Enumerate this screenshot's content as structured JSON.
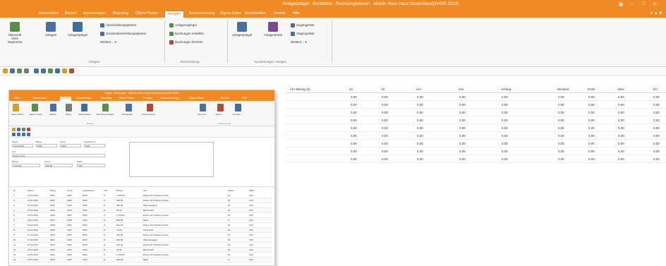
{
  "app": {
    "title": "Anlagespiegel · Kontierbar · Rechnungswesen · Muster Hous Haus Deutschland(AHKR 2010)",
    "window_controls": [
      "▣",
      "–",
      "□",
      "✕"
    ]
  },
  "menu": {
    "tabs": [
      "Stammdaten",
      "Buchen",
      "Auswertungen",
      "Reporting",
      "Offene Posten",
      "Anlagen",
      "Kostenrechnung",
      "Eigene Daten",
      "Schnittstellen",
      "Fenster",
      "Hilfe"
    ],
    "active_index": 5
  },
  "ribbon": {
    "buttons_large": [
      {
        "label": "Übersicht ohne Segmente",
        "icon": "overview-icon"
      },
      {
        "label": "Anlagen",
        "icon": "assets-icon"
      },
      {
        "label": "Anlagespiegel",
        "icon": "asset-register-icon"
      },
      {
        "label": "Anlagespiegel",
        "icon": "asset-chart-icon"
      },
      {
        "label": "Anlagenkarte",
        "icon": "asset-card-icon"
      }
    ],
    "small_items": [
      "Abschreibungsplanen",
      "Sonderabschreibungsplanen",
      "Weitere...",
      "Anlagenspiegel",
      "Buchungen erstellen",
      "Buchungen löschen",
      "Zugangsliste",
      "Abgangsliste",
      "Weitere..."
    ],
    "groups": [
      "Anlagen",
      "Abschreibung",
      "Auswertungen Anlagen"
    ]
  },
  "grid": {
    "columns": [
      "AfA-Betrag (€)",
      "Zu",
      "Ab",
      "Um",
      "Zus",
      "Anfang",
      "Bestand",
      "Ende",
      "Aktiv",
      "AfA"
    ],
    "row_value": "0,00",
    "row_count": 9
  },
  "dialog": {
    "title": "Stapel · Buchungen · Muster Hous Haus Deutschland (AHKR 2010)",
    "tabs": [
      "Start",
      "Stammdaten",
      "Buchen",
      "Auswertungen",
      "Reporting",
      "Offene Posten",
      "Anlagen",
      "Kostenrechnung",
      "Eigene Daten",
      "Fenster",
      "Hilfe"
    ],
    "active_tab": 2,
    "ribbon_labels": [
      "Stapel öffnen",
      "Stapel buchen",
      "Splitten",
      "Beleg",
      "Kostenstellen",
      "Buchungsvorlagen",
      "Belegbilder",
      "Auswertungen",
      "Summen",
      "Export",
      "Drucken"
    ],
    "ribbon_groups": [
      "Buchen",
      "Auswertungen"
    ],
    "form_labels": [
      "Datum",
      "Beleg",
      "Konto",
      "Gegenkonto",
      "Text",
      "Betrag",
      "Steuer",
      "Saldo"
    ],
    "form_values": [
      "13.04.2013",
      "3032",
      "1800",
      "8400",
      "Erlöse 19 %",
      "1.000,00",
      "190,00",
      "0,00"
    ],
    "table_headers": [
      "Nr.",
      "Datum",
      "Beleg",
      "Konto",
      "Gegenkonto",
      "S/H",
      "Betrag",
      "Text",
      "Steuer",
      "Saldo"
    ],
    "rows": [
      [
        "1",
        "13.04.2013",
        "3032",
        "1800",
        "8400",
        "S",
        "1.000,00",
        "Erlöse 19 % Muster Kunde",
        "19",
        "0,00"
      ],
      [
        "2",
        "13.04.2013",
        "3033",
        "1800",
        "8400",
        "S",
        "250,00",
        "Erlöse 19 % Muster Kunde",
        "19",
        "0,00"
      ],
      [
        "3",
        "14.04.2013",
        "3034",
        "1200",
        "3400",
        "H",
        "480,00",
        "Wareneingang",
        "19",
        "0,00"
      ],
      [
        "4",
        "14.04.2013",
        "3035",
        "1200",
        "4930",
        "H",
        "35,00",
        "Bürobedarf",
        "19",
        "0,00"
      ],
      [
        "5",
        "15.04.2013",
        "3036",
        "1800",
        "8400",
        "S",
        "1.200,00",
        "Erlöse 19 % Muster Kunde",
        "19",
        "0,00"
      ],
      [
        "6",
        "15.04.2013",
        "3037",
        "1200",
        "4210",
        "H",
        "800,00",
        "Miete",
        "0",
        "0,00"
      ],
      [
        "7",
        "16.04.2013",
        "3038",
        "1800",
        "8400",
        "S",
        "640,00",
        "Erlöse 19 % Muster Kunde",
        "19",
        "0,00"
      ],
      [
        "8",
        "16.04.2013",
        "3039",
        "1200",
        "4530",
        "H",
        "72,00",
        "Kfz-Kosten",
        "19",
        "0,00"
      ],
      [
        "9",
        "17.04.2013",
        "3040",
        "1800",
        "8400",
        "S",
        "310,00",
        "Erlöse 19 % Muster Kunde",
        "19",
        "0,00"
      ],
      [
        "10",
        "17.04.2013",
        "3041",
        "1200",
        "3400",
        "H",
        "920,00",
        "Wareneingang",
        "19",
        "0,00"
      ],
      [
        "11",
        "18.04.2013",
        "3042",
        "1800",
        "8400",
        "S",
        "150,00",
        "Erlöse 19 % Muster Kunde",
        "19",
        "0,00"
      ],
      [
        "12",
        "18.04.2013",
        "3043",
        "1200",
        "4930",
        "H",
        "18,00",
        "Bürobedarf",
        "19",
        "0,00"
      ],
      [
        "13",
        "19.04.2013",
        "3044",
        "1800",
        "8400",
        "S",
        "2.100,00",
        "Erlöse 19 % Muster Kunde",
        "19",
        "0,00"
      ],
      [
        "14",
        "19.04.2013",
        "3045",
        "1200",
        "4210",
        "H",
        "800,00",
        "Miete",
        "0",
        "0,00"
      ]
    ]
  },
  "colors": {
    "accent": "#f08a24",
    "ribbon_bg": "#f7f7f7"
  }
}
